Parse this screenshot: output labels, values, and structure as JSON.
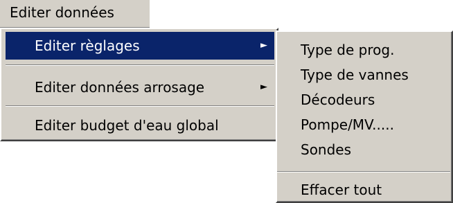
{
  "menu": {
    "title": "Editer données"
  },
  "main_menu": {
    "items": [
      {
        "label": "Editer règlages",
        "arrow": "►"
      },
      {
        "label": "Editer données arrosage",
        "arrow": "►"
      },
      {
        "label": "Editer budget d'eau global"
      }
    ]
  },
  "submenu": {
    "items": [
      {
        "label": "Type de prog."
      },
      {
        "label": "Type de vannes"
      },
      {
        "label": "Décodeurs"
      },
      {
        "label": "Pompe/MV....."
      },
      {
        "label": "Sondes"
      },
      {
        "label": "Effacer tout"
      }
    ]
  },
  "colors": {
    "menu_background": "#d4d0c8",
    "highlight": "#0a246a",
    "highlight_text": "#ffffff"
  }
}
